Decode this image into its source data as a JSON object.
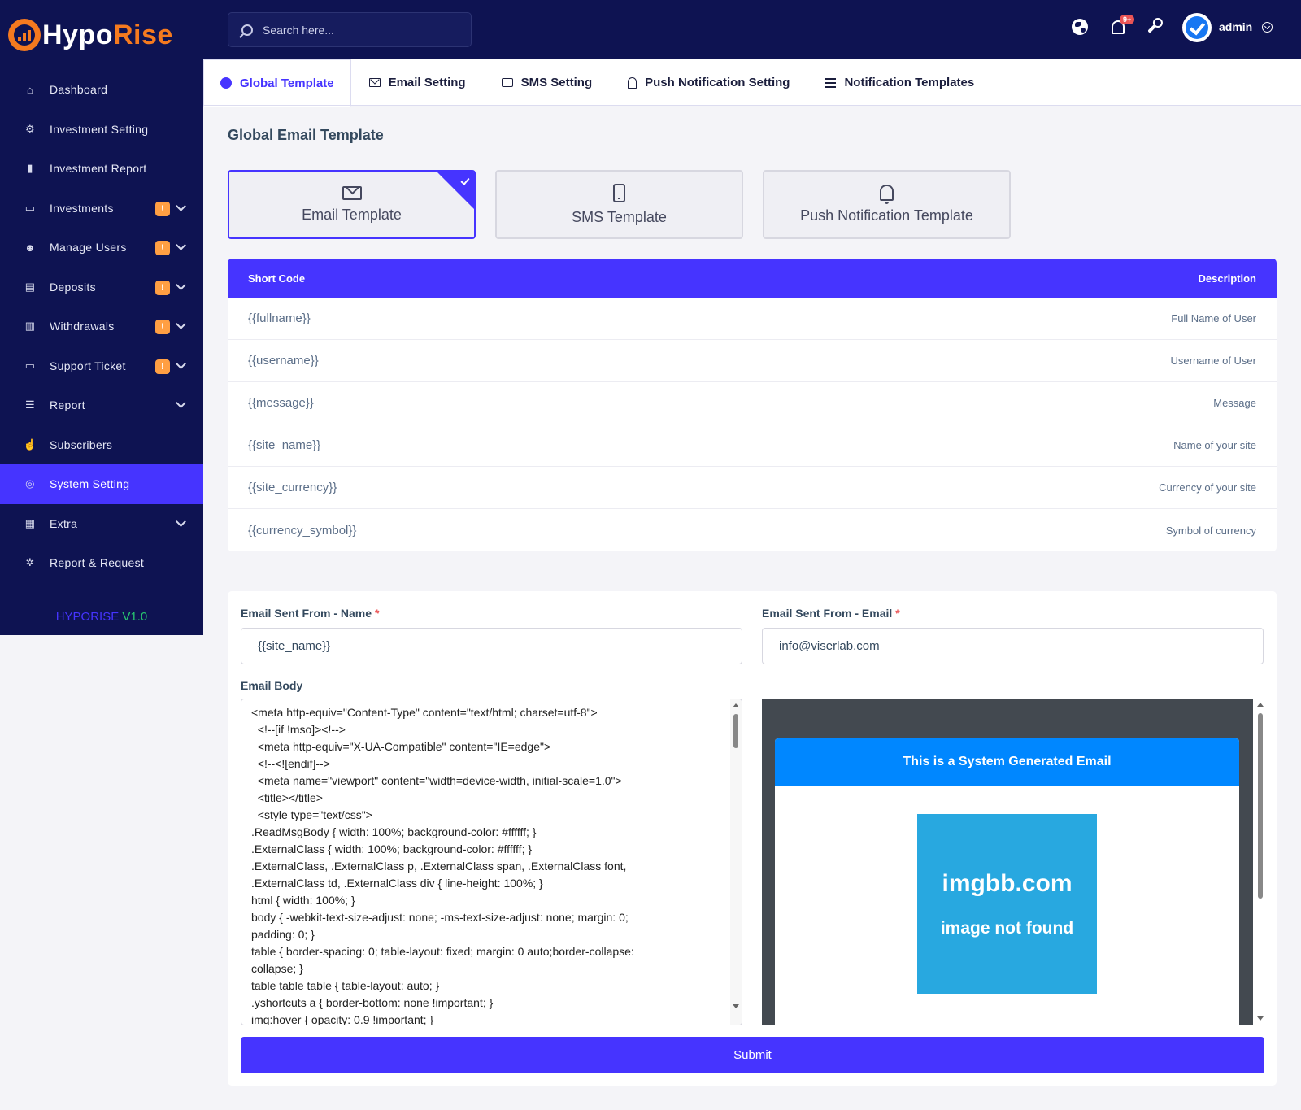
{
  "brand": {
    "part1": "Hypo",
    "part2": "Rise"
  },
  "sidebar": {
    "items": [
      {
        "label": "Dashboard",
        "icon": "home-icon",
        "badge": null,
        "chevron": false,
        "active": false
      },
      {
        "label": "Investment Setting",
        "icon": "nodes-icon",
        "badge": null,
        "chevron": false,
        "active": false
      },
      {
        "label": "Investment Report",
        "icon": "chart-icon",
        "badge": null,
        "chevron": false,
        "active": false
      },
      {
        "label": "Investments",
        "icon": "briefcase-icon",
        "badge": "!",
        "chevron": true,
        "active": false
      },
      {
        "label": "Manage Users",
        "icon": "users-icon",
        "badge": "!",
        "chevron": true,
        "active": false
      },
      {
        "label": "Deposits",
        "icon": "invoice-icon",
        "badge": "!",
        "chevron": true,
        "active": false
      },
      {
        "label": "Withdrawals",
        "icon": "bank-icon",
        "badge": "!",
        "chevron": true,
        "active": false
      },
      {
        "label": "Support Ticket",
        "icon": "ticket-icon",
        "badge": "!",
        "chevron": true,
        "active": false
      },
      {
        "label": "Report",
        "icon": "list-icon",
        "badge": null,
        "chevron": true,
        "active": false
      },
      {
        "label": "Subscribers",
        "icon": "thumbs-up-icon",
        "badge": null,
        "chevron": false,
        "active": false
      },
      {
        "label": "System Setting",
        "icon": "life-ring-icon",
        "badge": null,
        "chevron": false,
        "active": true
      },
      {
        "label": "Extra",
        "icon": "server-icon",
        "badge": null,
        "chevron": true,
        "active": false
      },
      {
        "label": "Report & Request",
        "icon": "bug-icon",
        "badge": null,
        "chevron": false,
        "active": false
      }
    ],
    "footer": {
      "name": "HYPORISE",
      "version": "V1.0"
    }
  },
  "topbar": {
    "search_placeholder": "Search here...",
    "notif_count": "9+",
    "user_name": "admin"
  },
  "tabs": [
    {
      "label": "Global Template",
      "icon": "globe",
      "active": true
    },
    {
      "label": "Email Setting",
      "icon": "env",
      "active": false
    },
    {
      "label": "SMS Setting",
      "icon": "chat",
      "active": false
    },
    {
      "label": "Push Notification Setting",
      "icon": "bell",
      "active": false
    },
    {
      "label": "Notification Templates",
      "icon": "list",
      "active": false
    }
  ],
  "section_title": "Global Email Template",
  "template_cards": [
    {
      "label": "Email Template",
      "icon": "mail",
      "active": true
    },
    {
      "label": "SMS Template",
      "icon": "phone",
      "active": false
    },
    {
      "label": "Push Notification Template",
      "icon": "bell",
      "active": false
    }
  ],
  "shortcodes": {
    "head_code": "Short Code",
    "head_desc": "Description",
    "rows": [
      {
        "code": "{{fullname}}",
        "desc": "Full Name of User"
      },
      {
        "code": "{{username}}",
        "desc": "Username of User"
      },
      {
        "code": "{{message}}",
        "desc": "Message"
      },
      {
        "code": "{{site_name}}",
        "desc": "Name of your site"
      },
      {
        "code": "{{site_currency}}",
        "desc": "Currency of your site"
      },
      {
        "code": "{{currency_symbol}}",
        "desc": "Symbol of currency"
      }
    ]
  },
  "form": {
    "from_name_label": "Email Sent From - Name",
    "from_name_value": "{{site_name}}",
    "from_email_label": "Email Sent From - Email",
    "from_email_value": "info@viserlab.com",
    "required_mark": "*",
    "body_label": "Email Body",
    "body_text": "<meta http-equiv=\"Content-Type\" content=\"text/html; charset=utf-8\">\n  <!--[if !mso]><!-->\n  <meta http-equiv=\"X-UA-Compatible\" content=\"IE=edge\">\n  <!--<![endif]-->\n  <meta name=\"viewport\" content=\"width=device-width, initial-scale=1.0\">\n  <title></title>\n  <style type=\"text/css\">\n.ReadMsgBody { width: 100%; background-color: #ffffff; }\n.ExternalClass { width: 100%; background-color: #ffffff; }\n.ExternalClass, .ExternalClass p, .ExternalClass span, .ExternalClass font,\n.ExternalClass td, .ExternalClass div { line-height: 100%; }\nhtml { width: 100%; }\nbody { -webkit-text-size-adjust: none; -ms-text-size-adjust: none; margin: 0;\npadding: 0; }\ntable { border-spacing: 0; table-layout: fixed; margin: 0 auto;border-collapse:\ncollapse; }\ntable table table { table-layout: auto; }\n.yshortcuts a { border-bottom: none !important; }\nimg:hover { opacity: 0.9 !important; }",
    "preview_header": "This is a System Generated Email",
    "preview_image_line1": "imgbb.com",
    "preview_image_line2": "image not found",
    "submit_label": "Submit"
  },
  "colors": {
    "primary": "#4634ff",
    "sidebar": "#0e1352",
    "accent": "#f57a1f",
    "badge": "#ff9f43"
  }
}
